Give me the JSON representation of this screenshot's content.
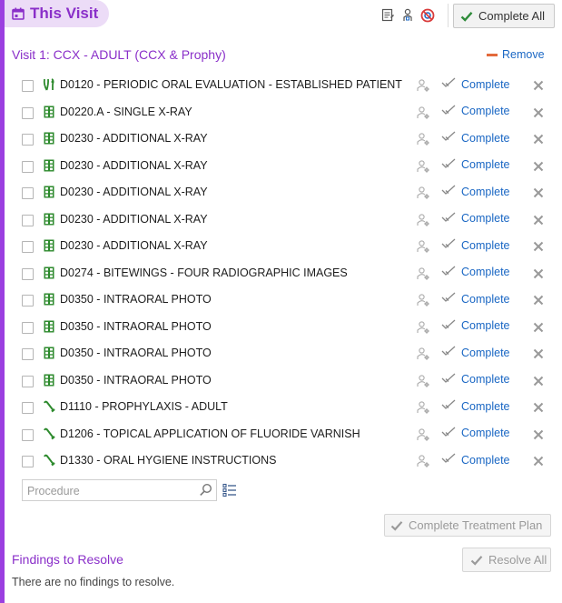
{
  "header": {
    "title": "This Visit",
    "complete_all_label": "Complete All",
    "accent_color": "#8a2fc9"
  },
  "visit": {
    "heading": "Visit 1: CCX - ADULT (CCX & Prophy)",
    "remove_label": "Remove"
  },
  "row_action": {
    "complete_label": "Complete"
  },
  "procedures": [
    {
      "icon": "tooth-exam-icon",
      "text": "D0120 - PERIODIC ORAL EVALUATION - ESTABLISHED PATIENT"
    },
    {
      "icon": "film-icon",
      "text": "D0220.A - SINGLE X-RAY"
    },
    {
      "icon": "film-icon",
      "text": "D0230 - ADDITIONAL X-RAY"
    },
    {
      "icon": "film-icon",
      "text": "D0230 - ADDITIONAL X-RAY"
    },
    {
      "icon": "film-icon",
      "text": "D0230 - ADDITIONAL X-RAY"
    },
    {
      "icon": "film-icon",
      "text": "D0230 - ADDITIONAL X-RAY"
    },
    {
      "icon": "film-icon",
      "text": "D0230 - ADDITIONAL X-RAY"
    },
    {
      "icon": "film-icon",
      "text": "D0274 - BITEWINGS - FOUR RADIOGRAPHIC IMAGES"
    },
    {
      "icon": "film-icon",
      "text": "D0350 - INTRAORAL PHOTO"
    },
    {
      "icon": "film-icon",
      "text": "D0350 - INTRAORAL PHOTO"
    },
    {
      "icon": "film-icon",
      "text": "D0350 - INTRAORAL PHOTO"
    },
    {
      "icon": "film-icon",
      "text": "D0350 - INTRAORAL PHOTO"
    },
    {
      "icon": "prophy-tool-icon",
      "text": "D1110 - PROPHYLAXIS - ADULT"
    },
    {
      "icon": "prophy-tool-icon",
      "text": "D1206 - TOPICAL APPLICATION OF FLUORIDE VARNISH"
    },
    {
      "icon": "prophy-tool-icon",
      "text": "D1330 - ORAL HYGIENE INSTRUCTIONS"
    }
  ],
  "procedure_search": {
    "placeholder": "Procedure"
  },
  "complete_treatment_plan_label": "Complete Treatment Plan",
  "findings": {
    "title": "Findings to Resolve",
    "resolve_all_label": "Resolve All",
    "empty_text": "There are no findings to resolve."
  }
}
